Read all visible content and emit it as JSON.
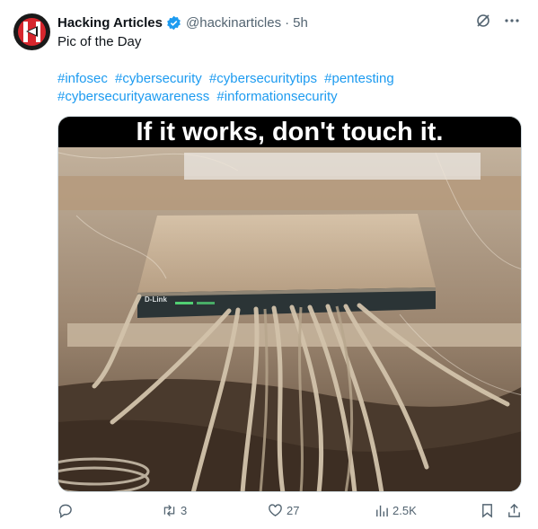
{
  "tweet": {
    "author_name": "Hacking Articles",
    "handle": "@hackinarticles",
    "separator": "·",
    "time": "5h",
    "text": "Pic of the Day",
    "hashtags": [
      "#infosec",
      "#cybersecurity",
      "#cybersecuritytips",
      "#pentesting",
      "#cybersecurityawareness",
      "#informationsecurity"
    ],
    "image_caption": "If it works, don't touch it.",
    "image_device_label": "D-Link"
  },
  "actions": {
    "replies": "",
    "retweets": "3",
    "likes": "27",
    "views": "2.5K"
  },
  "icons": {
    "verified": "verified-badge-icon",
    "grok": "grok-icon",
    "more": "more-icon",
    "reply": "reply-icon",
    "retweet": "retweet-icon",
    "like": "heart-icon",
    "views": "views-icon",
    "bookmark": "bookmark-icon",
    "share": "share-icon"
  },
  "colors": {
    "link": "#1d9bf0",
    "muted": "#536471",
    "verified": "#1d9bf0",
    "avatar_red": "#d7262d"
  }
}
